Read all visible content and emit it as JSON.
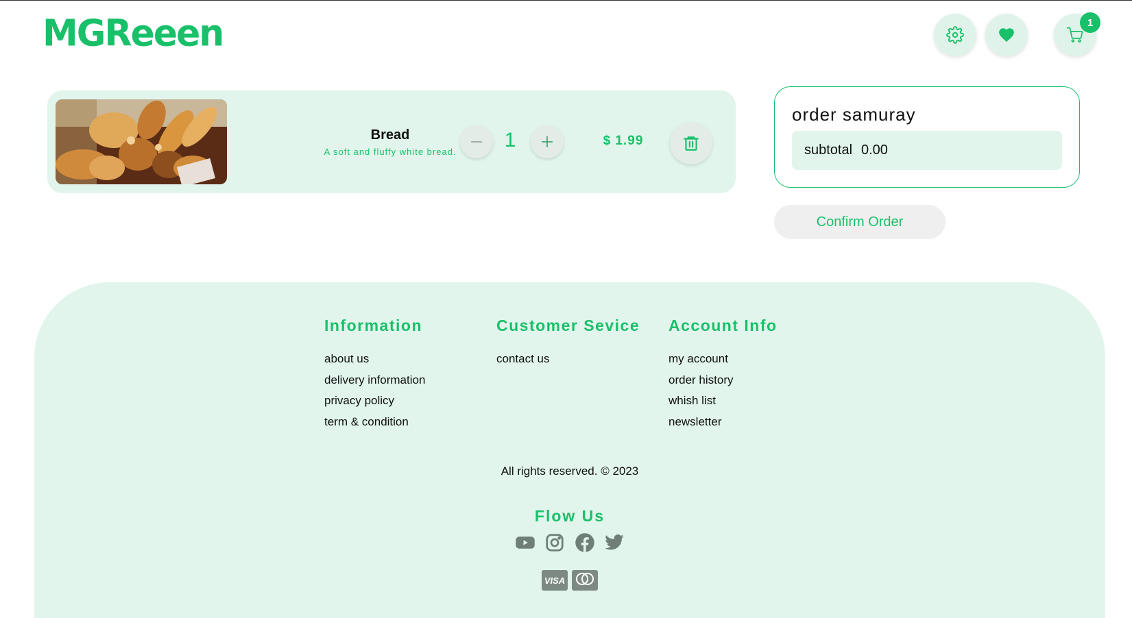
{
  "header": {
    "logo": "MGReeen",
    "cart_count": "1",
    "icons": [
      "gear-icon",
      "heart-icon",
      "cart-icon"
    ]
  },
  "cart": {
    "items": [
      {
        "name": "Bread",
        "description": "A soft and fluffy white bread.",
        "quantity": "1",
        "price": "$ 1.99"
      }
    ]
  },
  "summary": {
    "title": "order samuray",
    "subtotal_label": "subtotal",
    "subtotal_value": "0.00",
    "confirm_label": "Confirm Order"
  },
  "footer": {
    "columns": [
      {
        "title": "Information",
        "links": [
          "about us",
          "delivery information",
          "privacy policy",
          "term & condition"
        ]
      },
      {
        "title": "Customer Sevice",
        "links": [
          "contact us"
        ]
      },
      {
        "title": "Account Info",
        "links": [
          "my account",
          "order history",
          "whish list",
          "newsletter"
        ]
      }
    ],
    "copyright": "All rights reserved. © 2023",
    "follow_title": "Flow Us",
    "social_icons": [
      "youtube-icon",
      "instagram-icon",
      "facebook-icon",
      "twitter-icon"
    ],
    "payment_icons": [
      "visa-icon",
      "mastercard-icon"
    ]
  },
  "colors": {
    "accent": "#19c06a",
    "panel": "#e1f5ec",
    "icon_gray": "#7d8a84"
  }
}
